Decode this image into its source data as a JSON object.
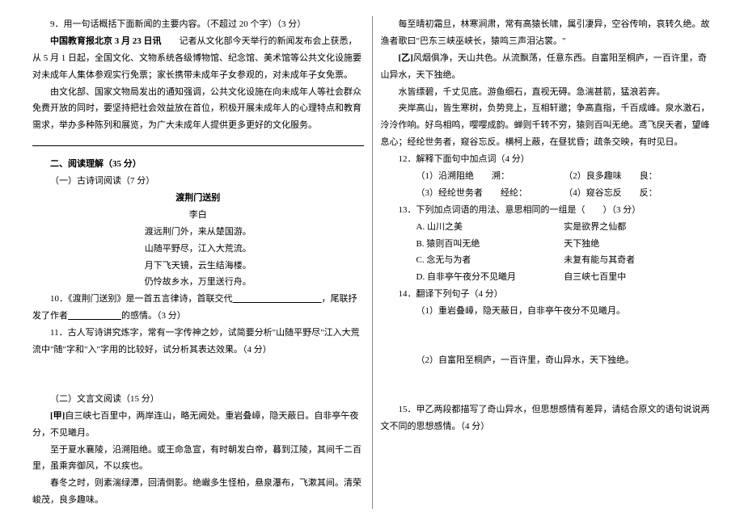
{
  "left": {
    "q9": {
      "prompt": "9．用一句话概括下面新闻的主要内容。（不超过 20 个字）（3 分）",
      "headline": "中国教育报北京 3 月 23 日讯",
      "headlineRest": "　　记者从文化部今天举行的新闻发布会上获悉，从 5 月 1 日起，全国文化、文物系统各级博物馆、纪念馆、美术馆等公共文化设施要对未成年人集体参观实行免票；家长携带未成年子女参观的，对未成年子女免票。",
      "para2": "由文化部、国家文物局发出的通知强调，公共文化设施在向未成年人等社会群众免费开放的同时，要坚持把社会效益放在首位，积极开展未成年人的心理特点和教育需求，举办多种陈列和展览，为广大未成年人提供更多更好的文化服务。"
    },
    "section2": {
      "title": "二、阅读理解（35 分）",
      "sub1": "（一）古诗词阅读（7 分）",
      "poemTitle": "渡荆门送别",
      "poemAuthor": "李白",
      "lines": [
        "渡远荆门外，来从楚国游。",
        "山随平野尽，江入大荒流。",
        "月下飞天镜，云生结海楼。",
        "仍怜故乡水，万里送行舟。"
      ],
      "q10a": "10．《渡荆门送别》是一首五言律诗，首联交代",
      "q10b": "，尾联抒发了作者",
      "q10c": "的感情。（3 分）",
      "q11": "11．古人写诗讲究炼字，常有一字传神之妙，试简要分析\"山随平野尽\"江入大荒流中\"随\"字和\"入\"字用的比较好，试分析其表达效果。（4 分）"
    },
    "wenyan": {
      "title": "（二）文言文阅读（15 分）",
      "jia1a": "[甲]",
      "jia1b": "自三峡七百里中，两岸连山，略无阙处。重岩叠嶂，隐天蔽日。自非亭午夜分，不见曦月。",
      "jia2": "至于夏水襄陵，沿溯阻绝。或王命急宣，有时朝发白帝，暮到江陵，其间千二百里，虽乘奔御风，不以疾也。",
      "jia3": "春冬之时，则素湍绿潭，回清倒影。绝𪩘多生怪柏，悬泉瀑布，飞漱其间。清荣峻茂，良多趣味。"
    }
  },
  "right": {
    "jia4": "每至晴初霜旦，林寒涧肃，常有高猿长啸，属引凄异，空谷传响，哀转久绝。故渔者歌曰\"巴东三峡巫峡长，猿鸣三声泪沾裳。\"",
    "yi1a": "[乙]",
    "yi1b": "风烟俱净，天山共色。从流飘荡，任意东西。自富阳至桐庐，一百许里，奇山异水，天下独绝。",
    "yi2": "水皆缥碧，千丈见底。游鱼细石，直视无碍。急湍甚箭，猛浪若奔。",
    "yi3": "夹岸高山，皆生寒树，负势竞上，互相轩邈；争高直指，千百成峰。泉水激石，泠泠作响。好鸟相鸣，嘤嘤成韵。蝉则千转不穷，猿则百叫无绝。鸢飞戾天者，望峰息心；经纶世务者，窥谷忘反。横柯上蔽，在昼犹昏；疏条交映，有时见日。",
    "q12": "12．解释下面句中加点词（4 分）",
    "q12a": "（1）沿溯阻绝　　溯：",
    "q12b": "（2）良多趣味　　良：",
    "q12c": "（3）经纶世务者　　经纶：",
    "q12d": "（4）窥谷忘反　　反：",
    "q13": "13．下列加点词语的用法、意思相同的一组是（　　）（3 分）",
    "q13a1": "A. 山川之美",
    "q13a2": "实是欲界之仙都",
    "q13b1": "B. 猿则百叫无绝",
    "q13b2": "天下独绝",
    "q13c1": "C. 念无与为者",
    "q13c2": "未复有能与其奇者",
    "q13d1": "D. 自非亭午夜分不见曦月",
    "q13d2": "自三峡七百里中",
    "q14": "14．翻译下列句子（4 分）",
    "q14a": "（1）重岩叠嶂，隐天蔽日，自非亭午夜分不见曦月。",
    "q14b": "（2）自富阳至桐庐，一百许里，奇山异水，天下独绝。",
    "q15": "15．甲乙两段都描写了奇山异水，但思想感情有差异，请结合原文的语句说说两文不同的思想感情。（4 分）"
  }
}
